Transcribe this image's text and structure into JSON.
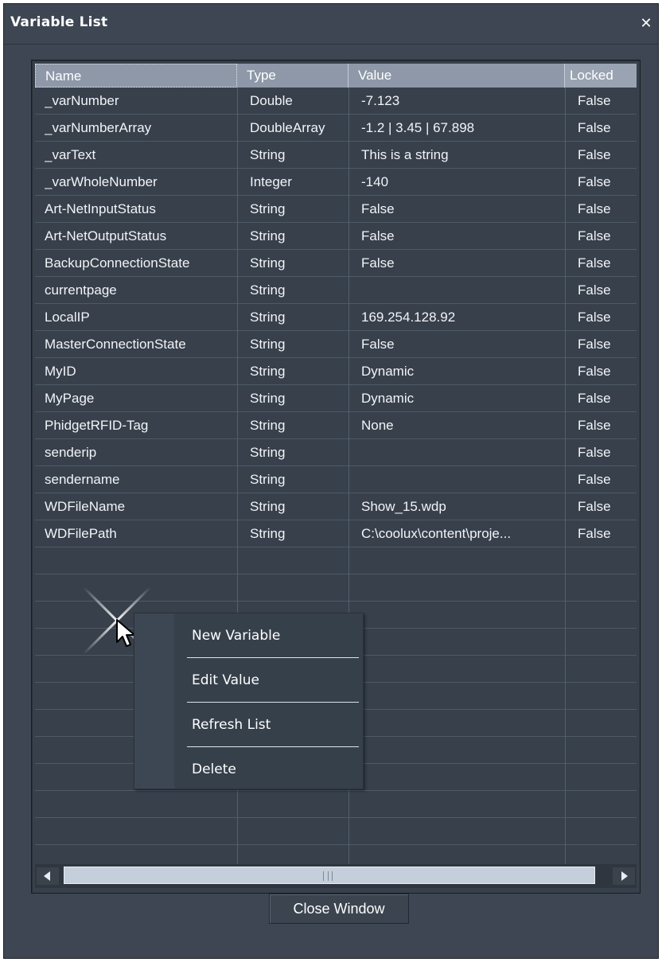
{
  "window": {
    "title": "Variable List"
  },
  "columns": [
    "Name",
    "Type",
    "Value",
    "Locked"
  ],
  "rows": [
    {
      "name": "_varNumber",
      "type": "Double",
      "value": "-7.123",
      "locked": "False"
    },
    {
      "name": "_varNumberArray",
      "type": "DoubleArray",
      "value": "-1.2 | 3.45 | 67.898",
      "locked": "False"
    },
    {
      "name": "_varText",
      "type": "String",
      "value": "This is a string",
      "locked": "False"
    },
    {
      "name": "_varWholeNumber",
      "type": "Integer",
      "value": "-140",
      "locked": "False"
    },
    {
      "name": "Art-NetInputStatus",
      "type": "String",
      "value": "False",
      "locked": "False"
    },
    {
      "name": "Art-NetOutputStatus",
      "type": "String",
      "value": "False",
      "locked": "False"
    },
    {
      "name": "BackupConnectionState",
      "type": "String",
      "value": "False",
      "locked": "False"
    },
    {
      "name": "currentpage",
      "type": "String",
      "value": "",
      "locked": "False"
    },
    {
      "name": "LocalIP",
      "type": "String",
      "value": "169.254.128.92",
      "locked": "False"
    },
    {
      "name": "MasterConnectionState",
      "type": "String",
      "value": "False",
      "locked": "False"
    },
    {
      "name": "MyID",
      "type": "String",
      "value": "Dynamic",
      "locked": "False"
    },
    {
      "name": "MyPage",
      "type": "String",
      "value": "Dynamic",
      "locked": "False"
    },
    {
      "name": "PhidgetRFID-Tag",
      "type": "String",
      "value": "None",
      "locked": "False"
    },
    {
      "name": "senderip",
      "type": "String",
      "value": "",
      "locked": "False"
    },
    {
      "name": "sendername",
      "type": "String",
      "value": "",
      "locked": "False"
    },
    {
      "name": "WDFileName",
      "type": "String",
      "value": "Show_15.wdp",
      "locked": "False"
    },
    {
      "name": "WDFilePath",
      "type": "String",
      "value": "C:\\coolux\\content\\proje...",
      "locked": "False"
    }
  ],
  "context_menu": {
    "items": [
      "New Variable",
      "Edit Value",
      "Refresh List",
      "Delete"
    ]
  },
  "footer": {
    "close_label": "Close Window"
  },
  "icons": {
    "close": "close-icon",
    "scroll_left": "arrow-left-icon",
    "scroll_right": "arrow-right-icon",
    "cursor": "mouse-pointer-icon"
  }
}
